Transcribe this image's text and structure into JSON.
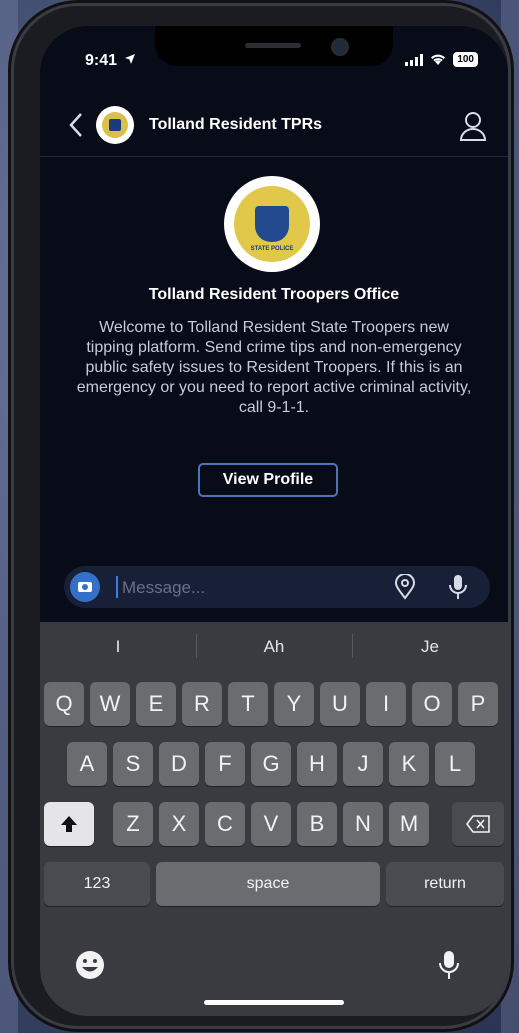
{
  "status_bar": {
    "time": "9:41",
    "battery": "100"
  },
  "header": {
    "title": "Tolland Resident TPRs"
  },
  "profile": {
    "name": "Tolland Resident Troopers Office",
    "welcome": "Welcome to Tolland Resident State Troopers new tipping platform.  Send crime tips and non-emergency public safety issues to Resident Troopers.  If this is an emergency or you need to report active criminal activity, call 9-1-1.",
    "view_profile_label": "View Profile",
    "seal_text": "STATE POLICE"
  },
  "composer": {
    "placeholder": "Message..."
  },
  "keyboard": {
    "suggestions": [
      "I",
      "Ah",
      "Je"
    ],
    "row1": [
      "Q",
      "W",
      "E",
      "R",
      "T",
      "Y",
      "U",
      "I",
      "O",
      "P"
    ],
    "row2": [
      "A",
      "S",
      "D",
      "F",
      "G",
      "H",
      "J",
      "K",
      "L"
    ],
    "row3": [
      "Z",
      "X",
      "C",
      "V",
      "B",
      "N",
      "M"
    ],
    "numbers_label": "123",
    "space_label": "space",
    "return_label": "return"
  },
  "colors": {
    "accent": "#3470c8",
    "background": "#080b18",
    "button_border": "#4d74b8"
  },
  "icons": [
    "location-arrow-icon",
    "back-chevron-icon",
    "person-icon",
    "camera-icon",
    "location-pin-icon",
    "microphone-icon",
    "shift-icon",
    "backspace-icon",
    "emoji-icon",
    "dictation-icon"
  ]
}
